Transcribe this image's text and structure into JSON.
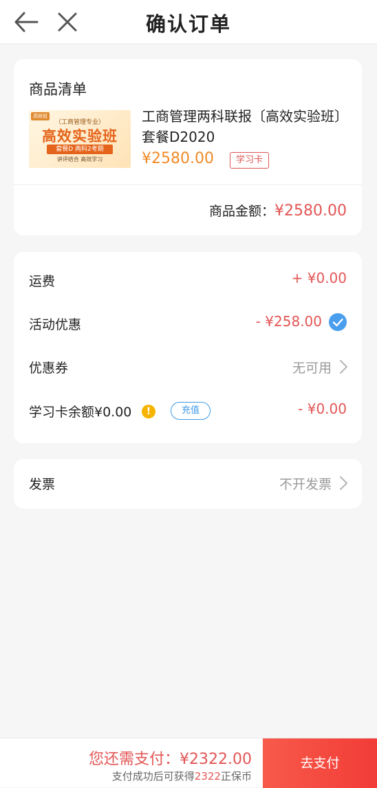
{
  "header": {
    "title": "确认订单"
  },
  "product_card": {
    "section_title": "商品清单",
    "thumbnail": {
      "corner_tag": "高效班",
      "line1": "（工商管理专业）",
      "line2": "高效实验班",
      "line3": "套餐D  两科2考期",
      "line4": "讲评结合   高效学习"
    },
    "name": "工商管理两科联报〔高效实验班〕套餐D2020",
    "price": "¥2580.00",
    "tag": "学习卡",
    "total_label": "商品金额：",
    "total_amount": "¥2580.00"
  },
  "fees": {
    "shipping": {
      "label": "运费",
      "value": "+ ¥0.00"
    },
    "promotion": {
      "label": "活动优惠",
      "value": "- ¥258.00"
    },
    "coupon": {
      "label": "优惠券",
      "value": "无可用"
    },
    "card_balance": {
      "label": "学习卡余额¥0.00",
      "warn": "!",
      "recharge": "充值",
      "value": "- ¥0.00"
    }
  },
  "invoice": {
    "label": "发票",
    "value": "不开发票"
  },
  "footer": {
    "need_pay_label": "您还需支付：",
    "need_pay_amount": "¥2322.00",
    "sub_prefix": "支付成功后可获得",
    "sub_points": "2322",
    "sub_suffix": "正保币",
    "pay_button": "去支付"
  },
  "colors": {
    "accent_red": "#e35555",
    "price_orange": "#f08a28",
    "link_blue": "#3d9ae6",
    "check_blue": "#4a9eee"
  }
}
